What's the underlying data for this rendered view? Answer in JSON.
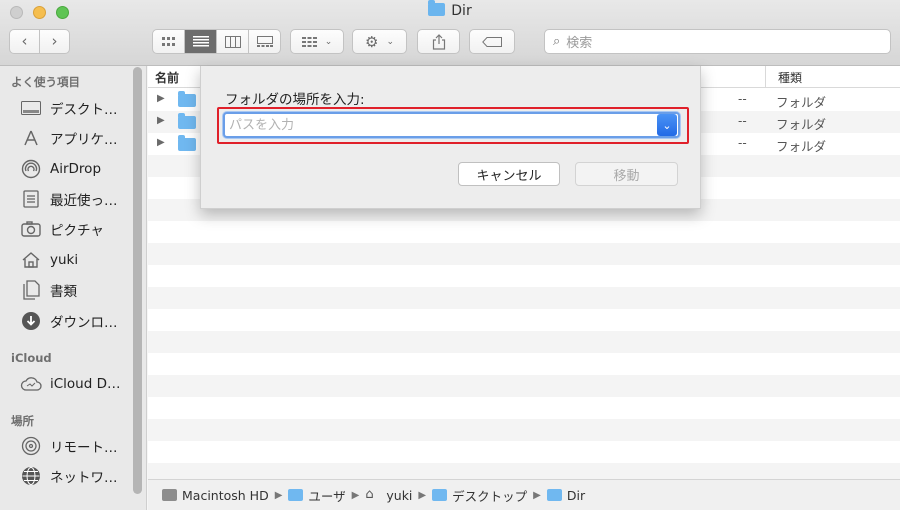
{
  "window": {
    "title": "Dir"
  },
  "toolbar": {
    "back_icon": "chevron-left-icon",
    "forward_icon": "chevron-right-icon",
    "search_placeholder": "検索"
  },
  "sidebar": {
    "sections": [
      {
        "header": "よく使う項目",
        "items": [
          {
            "label": "デスクト…",
            "icon": "desktop-icon"
          },
          {
            "label": "アプリケ…",
            "icon": "applications-icon"
          },
          {
            "label": "AirDrop",
            "icon": "airdrop-icon"
          },
          {
            "label": "最近使っ…",
            "icon": "recents-icon"
          },
          {
            "label": "ピクチャ",
            "icon": "camera-icon"
          },
          {
            "label": "yuki",
            "icon": "home-icon"
          },
          {
            "label": "書類",
            "icon": "documents-icon"
          },
          {
            "label": "ダウンロ…",
            "icon": "download-icon"
          }
        ]
      },
      {
        "header": "iCloud",
        "items": [
          {
            "label": "iCloud D…",
            "icon": "icloud-icon"
          }
        ]
      },
      {
        "header": "場所",
        "items": [
          {
            "label": "リモート…",
            "icon": "remote-disc-icon"
          },
          {
            "label": "ネットワ…",
            "icon": "network-icon"
          }
        ]
      }
    ]
  },
  "list": {
    "col_name": "名前",
    "col_kind": "種類",
    "rows": [
      {
        "size": "--",
        "kind": "フォルダ"
      },
      {
        "size": "--",
        "kind": "フォルダ"
      },
      {
        "size": "--",
        "kind": "フォルダ"
      }
    ]
  },
  "pathbar": {
    "crumbs": [
      "Macintosh HD",
      "ユーザ",
      "yuki",
      "デスクトップ",
      "Dir"
    ]
  },
  "sheet": {
    "label": "フォルダの場所を入力:",
    "input_value": "",
    "input_placeholder": "パスを入力",
    "cancel_label": "キャンセル",
    "move_label": "移動"
  }
}
